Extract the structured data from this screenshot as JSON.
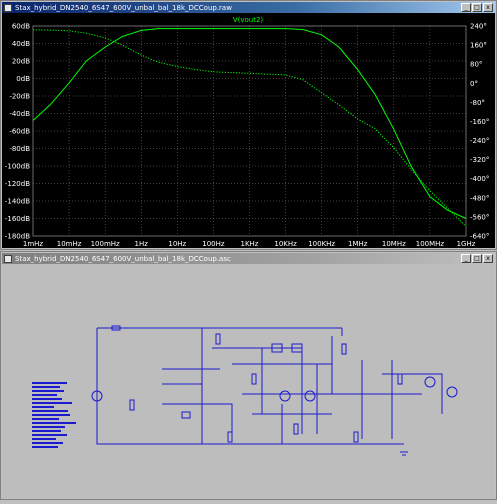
{
  "plot_window": {
    "title": "Stax_hybrid_DN2540_6S47_600V_unbal_bal_18k_DCCoup.raw",
    "trace_label": "V(vout2)",
    "buttons": {
      "minimize": "_",
      "maximize": "□",
      "close": "x"
    }
  },
  "schematic_window": {
    "title": "Stax_hybrid_DN2540_6S47_600V_unbal_bal_18k_DCCoup.asc",
    "buttons": {
      "minimize": "_",
      "maximize": "□",
      "close": "x"
    }
  },
  "chart_data": {
    "type": "line",
    "x_scale": "log",
    "x_ticks": [
      "1mHz",
      "10mHz",
      "100mHz",
      "1Hz",
      "10Hz",
      "100Hz",
      "1KHz",
      "10KHz",
      "100KHz",
      "1MHz",
      "10MHz",
      "100MHz",
      "1GHz"
    ],
    "x_tick_values": [
      0.001,
      0.01,
      0.1,
      1,
      10,
      100,
      1000,
      10000,
      100000,
      1000000,
      10000000,
      100000000,
      1000000000
    ],
    "y_left_ticks": [
      "60dB",
      "40dB",
      "20dB",
      "0dB",
      "-20dB",
      "-40dB",
      "-60dB",
      "-80dB",
      "-100dB",
      "-120dB",
      "-140dB",
      "-160dB",
      "-180dB"
    ],
    "y_left_range": [
      -180,
      60
    ],
    "y_right_ticks": [
      "240°",
      "160°",
      "80°",
      "0°",
      "-80°",
      "-160°",
      "-240°",
      "-320°",
      "-400°",
      "-480°",
      "-560°",
      "-640°"
    ],
    "y_right_range": [
      -640,
      240
    ],
    "grid": true,
    "colors": {
      "trace": "#00ff00",
      "grid": "#808080",
      "axis_text": "#ffffff",
      "background": "#000000"
    },
    "series": [
      {
        "name": "V(vout2)",
        "axis": "left",
        "style": "solid",
        "x": [
          0.001,
          0.003,
          0.01,
          0.03,
          0.1,
          0.3,
          1,
          3,
          10,
          100,
          1000,
          10000,
          30000,
          100000,
          300000,
          1000000,
          3000000,
          10000000,
          30000000,
          100000000,
          300000000,
          1000000000
        ],
        "y": [
          -48,
          -30,
          -5,
          20,
          36,
          48,
          55,
          57,
          57,
          57,
          57,
          57,
          56,
          50,
          36,
          10,
          -18,
          -58,
          -100,
          -135,
          -150,
          -160
        ]
      },
      {
        "name": "",
        "axis": "right",
        "style": "dotted",
        "x": [
          0.001,
          0.003,
          0.01,
          0.03,
          0.1,
          0.3,
          1,
          3,
          10,
          30,
          100,
          1000,
          10000,
          30000,
          100000,
          300000,
          1000000,
          3000000,
          10000000,
          30000000,
          100000000,
          1000000000
        ],
        "y": [
          224,
          223,
          220,
          210,
          190,
          160,
          118,
          88,
          70,
          58,
          48,
          42,
          35,
          15,
          -40,
          -90,
          -150,
          -190,
          -270,
          -360,
          -450,
          -600
        ]
      }
    ]
  }
}
